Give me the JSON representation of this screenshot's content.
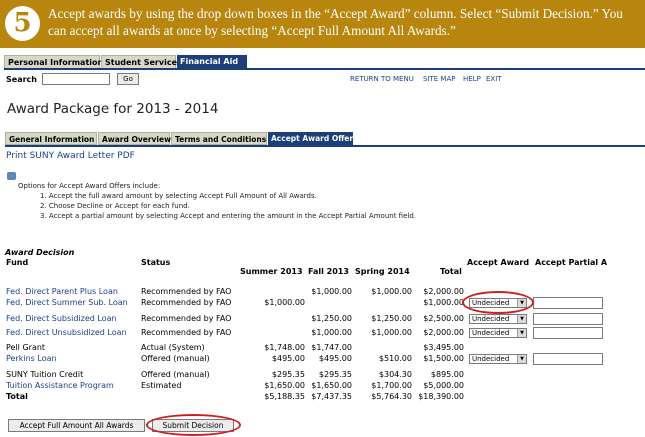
{
  "banner": {
    "step": "5",
    "text": "Accept awards by using the drop down boxes in the “Accept Award” column. Select “Submit Decision.” You can accept all awards at once by selecting “Accept Full Amount All Awards.”",
    "bg_color": "#b8860f"
  },
  "top_tabs": [
    {
      "label": "Personal Information",
      "active": false
    },
    {
      "label": "Student Services",
      "active": false
    },
    {
      "label": "Financial Aid",
      "active": true
    }
  ],
  "search": {
    "label": "Search",
    "go_label": "Go",
    "value": ""
  },
  "header_links": [
    "RETURN TO MENU",
    "SITE MAP",
    "HELP",
    "EXIT"
  ],
  "page_title": "Award Package for 2013 - 2014",
  "sub_tabs": [
    {
      "label": "General Information",
      "active": false
    },
    {
      "label": "Award Overview",
      "active": false
    },
    {
      "label": "Terms and Conditions",
      "active": false
    },
    {
      "label": "Accept Award Offer",
      "active": true
    }
  ],
  "print_link": "Print SUNY Award Letter PDF",
  "options": {
    "intro": "Options for Accept Award Offers include:",
    "items": [
      "1. Accept the full award amount by selecting Accept Full Amount of All Awards.",
      "2. Choose Decline or Accept for each fund.",
      "3. Accept a partial amount by selecting Accept and entering the amount in the Accept Partial Amount field."
    ]
  },
  "award_decision": {
    "heading": "Award Decision",
    "columns": {
      "fund": "Fund",
      "status": "Status",
      "summer": "Summer 2013",
      "fall": "Fall 2013",
      "spring": "Spring 2014",
      "total": "Total",
      "accept": "Accept Award",
      "partial": "Accept Partial A"
    },
    "rows": [
      {
        "fund": "Fed. Direct Parent Plus Loan",
        "status": "Recommended by FAO",
        "summer": "",
        "fall": "$1,000.00",
        "spring": "$1,000.00",
        "total": "$2,000.00",
        "accept": ""
      },
      {
        "fund": "Fed. Direct Summer Sub. Loan",
        "status": "Recommended by FAO",
        "summer": "$1,000.00",
        "fall": "",
        "spring": "",
        "total": "$1,000.00",
        "accept": "Undecided"
      },
      {
        "fund": "Fed. Direct Subsidized Loan",
        "status": "Recommended by FAO",
        "summer": "",
        "fall": "$1,250.00",
        "spring": "$1,250.00",
        "total": "$2,500.00",
        "accept": "Undecided"
      },
      {
        "fund": "Fed. Direct Unsubsidized Loan",
        "status": "Recommended by FAO",
        "summer": "",
        "fall": "$1,000.00",
        "spring": "$1,000.00",
        "total": "$2,000.00",
        "accept": "Undecided"
      },
      {
        "fund": "Pell Grant",
        "status": "Actual (System)",
        "summer": "$1,748.00",
        "fall": "$1,747.00",
        "spring": "",
        "total": "$3,495.00",
        "accept": ""
      },
      {
        "fund": "Perkins Loan",
        "status": "Offered (manual)",
        "summer": "$495.00",
        "fall": "$495.00",
        "spring": "$510.00",
        "total": "$1,500.00",
        "accept": "Undecided"
      },
      {
        "fund": "SUNY Tuition Credit",
        "status": "Offered (manual)",
        "summer": "$295.35",
        "fall": "$295.35",
        "spring": "$304.30",
        "total": "$895.00",
        "accept": ""
      },
      {
        "fund": "Tuition Assistance Program",
        "status": "Estimated",
        "summer": "$1,650.00",
        "fall": "$1,650.00",
        "spring": "$1,700.00",
        "total": "$5,000.00",
        "accept": ""
      },
      {
        "fund": "Total",
        "status": "",
        "summer": "$5,188.35",
        "fall": "$7,437.35",
        "spring": "$5,764.30",
        "total": "$18,390.00",
        "accept": ""
      }
    ]
  },
  "buttons": {
    "accept_all": "Accept Full Amount All Awards",
    "submit": "Submit Decision"
  },
  "colors": {
    "accent": "#1c3f7a",
    "link": "#1b3f8c",
    "highlight": "#cc1f1f"
  }
}
